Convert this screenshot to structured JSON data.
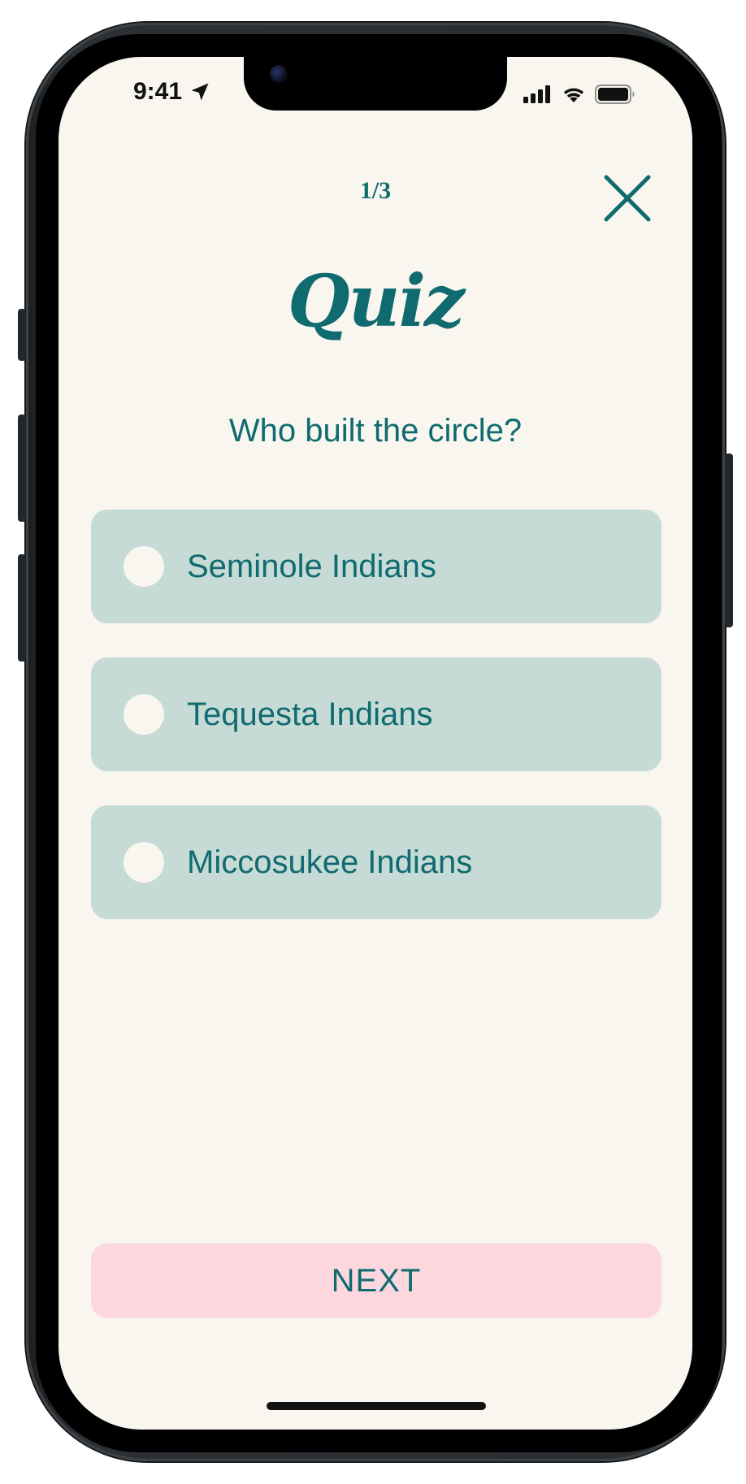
{
  "status_bar": {
    "time": "9:41",
    "icons": [
      "location-arrow-icon",
      "cellular-signal-icon",
      "wifi-icon",
      "battery-icon"
    ]
  },
  "quiz": {
    "progress": "1/3",
    "title": "Quiz",
    "question": "Who built the circle?",
    "options": [
      {
        "label": "Seminole Indians",
        "selected": false
      },
      {
        "label": "Tequesta Indians",
        "selected": false
      },
      {
        "label": "Miccosukee Indians",
        "selected": false
      }
    ],
    "next_label": "NEXT",
    "close_icon": "close-icon"
  },
  "colors": {
    "background": "#f8f6ef",
    "accent": "#0f6b6f",
    "option_bg": "#c7dbd6",
    "next_bg": "#fcd8de"
  }
}
